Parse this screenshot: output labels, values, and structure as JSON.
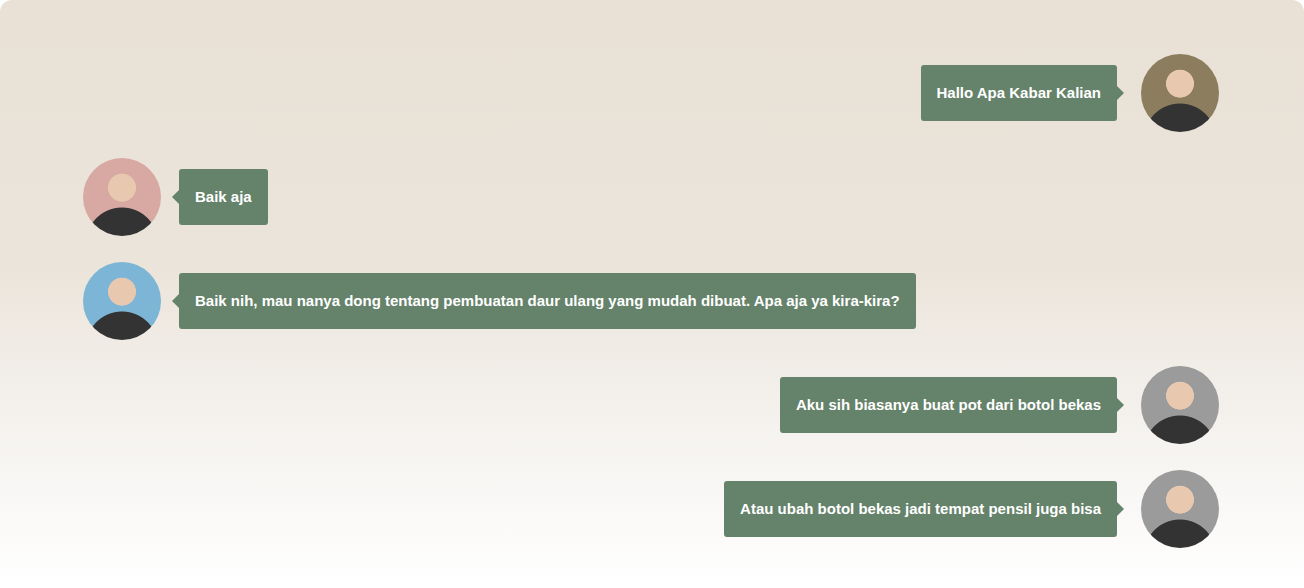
{
  "chat": {
    "messages": [
      {
        "text": "Hallo Apa Kabar Kalian",
        "kind": "outgoing",
        "color": "#8c7d5e"
      },
      {
        "text": "Baik aja",
        "kind": "incoming",
        "color": "#d8a9a3"
      },
      {
        "text": "Baik nih, mau nanya dong tentang pembuatan daur ulang yang mudah dibuat. Apa aja ya kira-kira?",
        "kind": "incoming",
        "color": "#7db5d6"
      },
      {
        "text": "Aku sih biasanya buat pot dari botol bekas",
        "kind": "outgoing",
        "color": "#9b9b9b"
      },
      {
        "text": "Atau ubah botol bekas jadi tempat pensil juga bisa",
        "kind": "outgoing",
        "color": "#9b9b9b"
      }
    ]
  }
}
